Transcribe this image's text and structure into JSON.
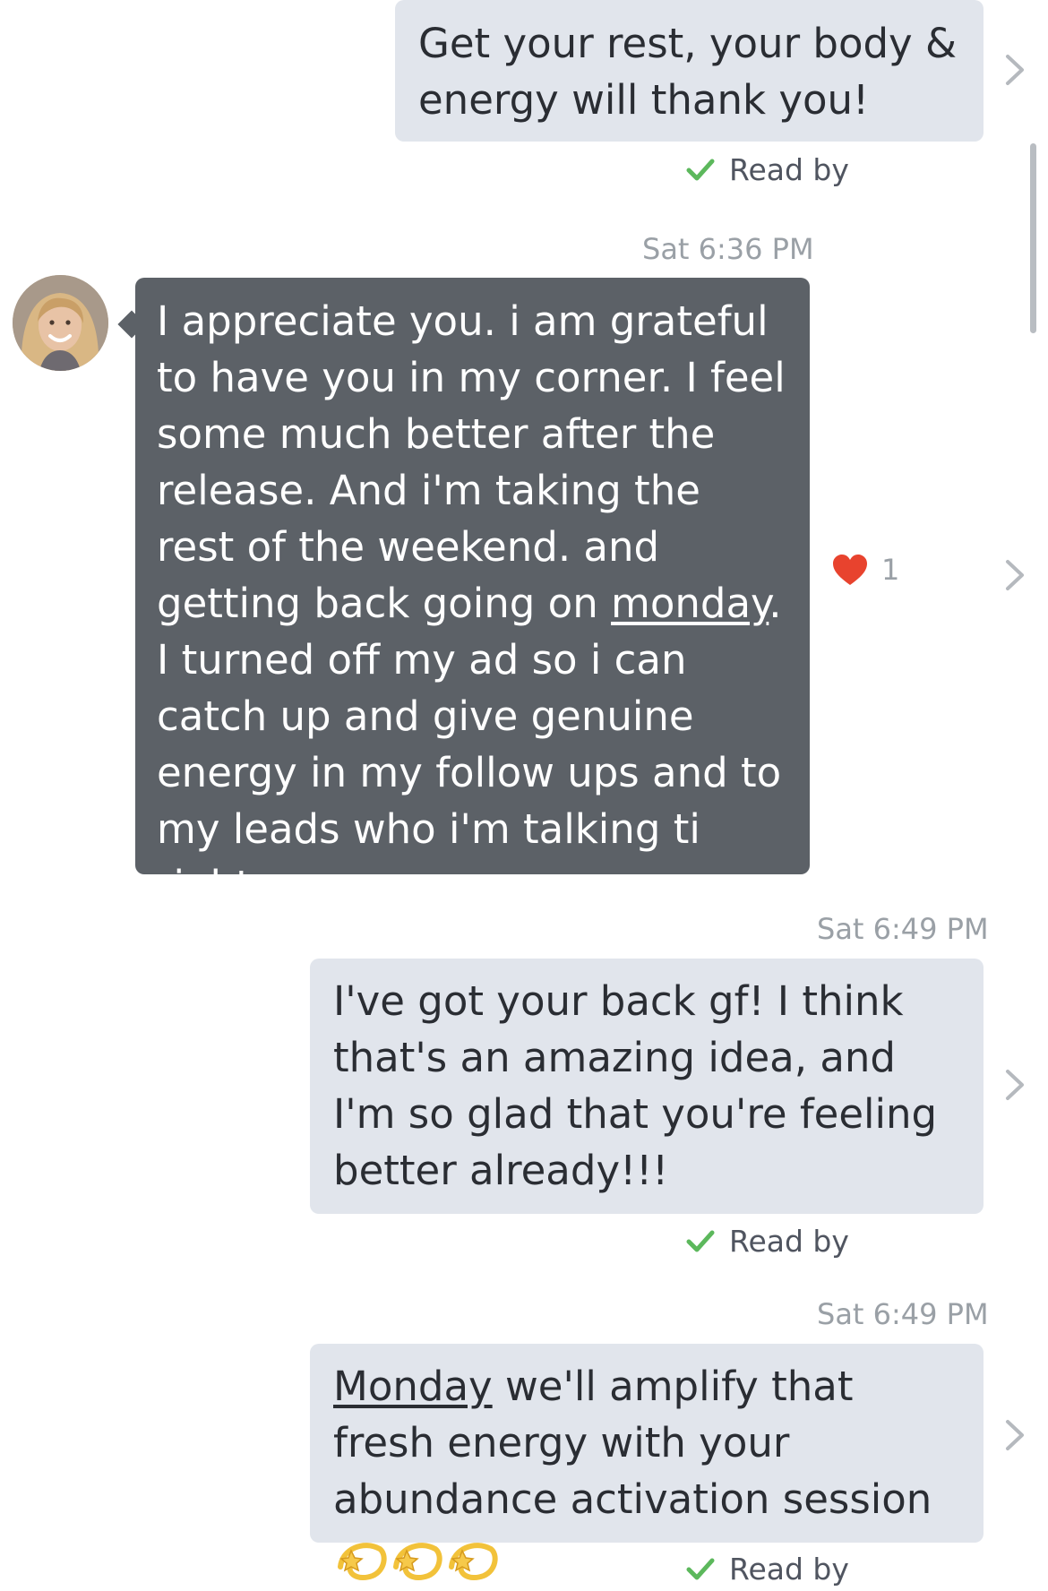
{
  "messages": [
    {
      "direction": "outgoing",
      "text": "Get your rest, your body & energy will thank you!",
      "read_label": "Read by"
    },
    {
      "direction": "incoming",
      "timestamp": "Sat 6:36 PM",
      "text_before": "I appreciate you. i am grateful to have you in my corner. I feel some much better after the release. And i'm taking the rest of the weekend. and getting back going on ",
      "text_underlined": "monday",
      "text_after": ". I turned off my ad so i can catch up and give genuine energy in my follow ups and to my leads who i'm talking ti right now",
      "reaction_icon": "heart-icon",
      "reaction_color": "#e8432e",
      "reaction_count": "1"
    },
    {
      "direction": "outgoing",
      "timestamp": "Sat 6:49 PM",
      "text": "I've got your back gf! I think that's an amazing idea, and I'm so glad that you're feeling better already!!!",
      "read_label": "Read by"
    },
    {
      "direction": "outgoing",
      "timestamp": "Sat 6:49 PM",
      "text_underlined": "Monday",
      "text_after": " we'll amplify that fresh energy with your abundance activation session ",
      "emoji": [
        "dizzy-star-emoji",
        "dizzy-star-emoji",
        "dizzy-star-emoji"
      ],
      "read_label": "Read by"
    }
  ],
  "colors": {
    "outgoing_bubble": "#e1e5ec",
    "incoming_bubble": "#5c6167",
    "read_check": "#5cb85c",
    "timestamp": "#9aa0a6"
  }
}
